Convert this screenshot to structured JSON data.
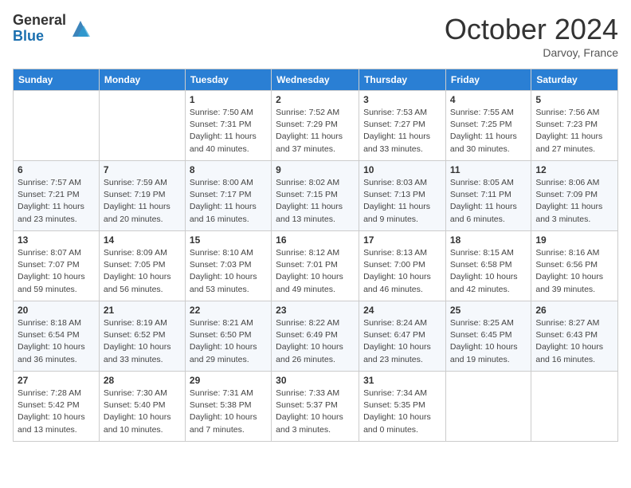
{
  "header": {
    "logo_general": "General",
    "logo_blue": "Blue",
    "month": "October 2024",
    "location": "Darvoy, France"
  },
  "days_of_week": [
    "Sunday",
    "Monday",
    "Tuesday",
    "Wednesday",
    "Thursday",
    "Friday",
    "Saturday"
  ],
  "weeks": [
    [
      {
        "day": "",
        "info": ""
      },
      {
        "day": "",
        "info": ""
      },
      {
        "day": "1",
        "info": "Sunrise: 7:50 AM\nSunset: 7:31 PM\nDaylight: 11 hours and 40 minutes."
      },
      {
        "day": "2",
        "info": "Sunrise: 7:52 AM\nSunset: 7:29 PM\nDaylight: 11 hours and 37 minutes."
      },
      {
        "day": "3",
        "info": "Sunrise: 7:53 AM\nSunset: 7:27 PM\nDaylight: 11 hours and 33 minutes."
      },
      {
        "day": "4",
        "info": "Sunrise: 7:55 AM\nSunset: 7:25 PM\nDaylight: 11 hours and 30 minutes."
      },
      {
        "day": "5",
        "info": "Sunrise: 7:56 AM\nSunset: 7:23 PM\nDaylight: 11 hours and 27 minutes."
      }
    ],
    [
      {
        "day": "6",
        "info": "Sunrise: 7:57 AM\nSunset: 7:21 PM\nDaylight: 11 hours and 23 minutes."
      },
      {
        "day": "7",
        "info": "Sunrise: 7:59 AM\nSunset: 7:19 PM\nDaylight: 11 hours and 20 minutes."
      },
      {
        "day": "8",
        "info": "Sunrise: 8:00 AM\nSunset: 7:17 PM\nDaylight: 11 hours and 16 minutes."
      },
      {
        "day": "9",
        "info": "Sunrise: 8:02 AM\nSunset: 7:15 PM\nDaylight: 11 hours and 13 minutes."
      },
      {
        "day": "10",
        "info": "Sunrise: 8:03 AM\nSunset: 7:13 PM\nDaylight: 11 hours and 9 minutes."
      },
      {
        "day": "11",
        "info": "Sunrise: 8:05 AM\nSunset: 7:11 PM\nDaylight: 11 hours and 6 minutes."
      },
      {
        "day": "12",
        "info": "Sunrise: 8:06 AM\nSunset: 7:09 PM\nDaylight: 11 hours and 3 minutes."
      }
    ],
    [
      {
        "day": "13",
        "info": "Sunrise: 8:07 AM\nSunset: 7:07 PM\nDaylight: 10 hours and 59 minutes."
      },
      {
        "day": "14",
        "info": "Sunrise: 8:09 AM\nSunset: 7:05 PM\nDaylight: 10 hours and 56 minutes."
      },
      {
        "day": "15",
        "info": "Sunrise: 8:10 AM\nSunset: 7:03 PM\nDaylight: 10 hours and 53 minutes."
      },
      {
        "day": "16",
        "info": "Sunrise: 8:12 AM\nSunset: 7:01 PM\nDaylight: 10 hours and 49 minutes."
      },
      {
        "day": "17",
        "info": "Sunrise: 8:13 AM\nSunset: 7:00 PM\nDaylight: 10 hours and 46 minutes."
      },
      {
        "day": "18",
        "info": "Sunrise: 8:15 AM\nSunset: 6:58 PM\nDaylight: 10 hours and 42 minutes."
      },
      {
        "day": "19",
        "info": "Sunrise: 8:16 AM\nSunset: 6:56 PM\nDaylight: 10 hours and 39 minutes."
      }
    ],
    [
      {
        "day": "20",
        "info": "Sunrise: 8:18 AM\nSunset: 6:54 PM\nDaylight: 10 hours and 36 minutes."
      },
      {
        "day": "21",
        "info": "Sunrise: 8:19 AM\nSunset: 6:52 PM\nDaylight: 10 hours and 33 minutes."
      },
      {
        "day": "22",
        "info": "Sunrise: 8:21 AM\nSunset: 6:50 PM\nDaylight: 10 hours and 29 minutes."
      },
      {
        "day": "23",
        "info": "Sunrise: 8:22 AM\nSunset: 6:49 PM\nDaylight: 10 hours and 26 minutes."
      },
      {
        "day": "24",
        "info": "Sunrise: 8:24 AM\nSunset: 6:47 PM\nDaylight: 10 hours and 23 minutes."
      },
      {
        "day": "25",
        "info": "Sunrise: 8:25 AM\nSunset: 6:45 PM\nDaylight: 10 hours and 19 minutes."
      },
      {
        "day": "26",
        "info": "Sunrise: 8:27 AM\nSunset: 6:43 PM\nDaylight: 10 hours and 16 minutes."
      }
    ],
    [
      {
        "day": "27",
        "info": "Sunrise: 7:28 AM\nSunset: 5:42 PM\nDaylight: 10 hours and 13 minutes."
      },
      {
        "day": "28",
        "info": "Sunrise: 7:30 AM\nSunset: 5:40 PM\nDaylight: 10 hours and 10 minutes."
      },
      {
        "day": "29",
        "info": "Sunrise: 7:31 AM\nSunset: 5:38 PM\nDaylight: 10 hours and 7 minutes."
      },
      {
        "day": "30",
        "info": "Sunrise: 7:33 AM\nSunset: 5:37 PM\nDaylight: 10 hours and 3 minutes."
      },
      {
        "day": "31",
        "info": "Sunrise: 7:34 AM\nSunset: 5:35 PM\nDaylight: 10 hours and 0 minutes."
      },
      {
        "day": "",
        "info": ""
      },
      {
        "day": "",
        "info": ""
      }
    ]
  ]
}
